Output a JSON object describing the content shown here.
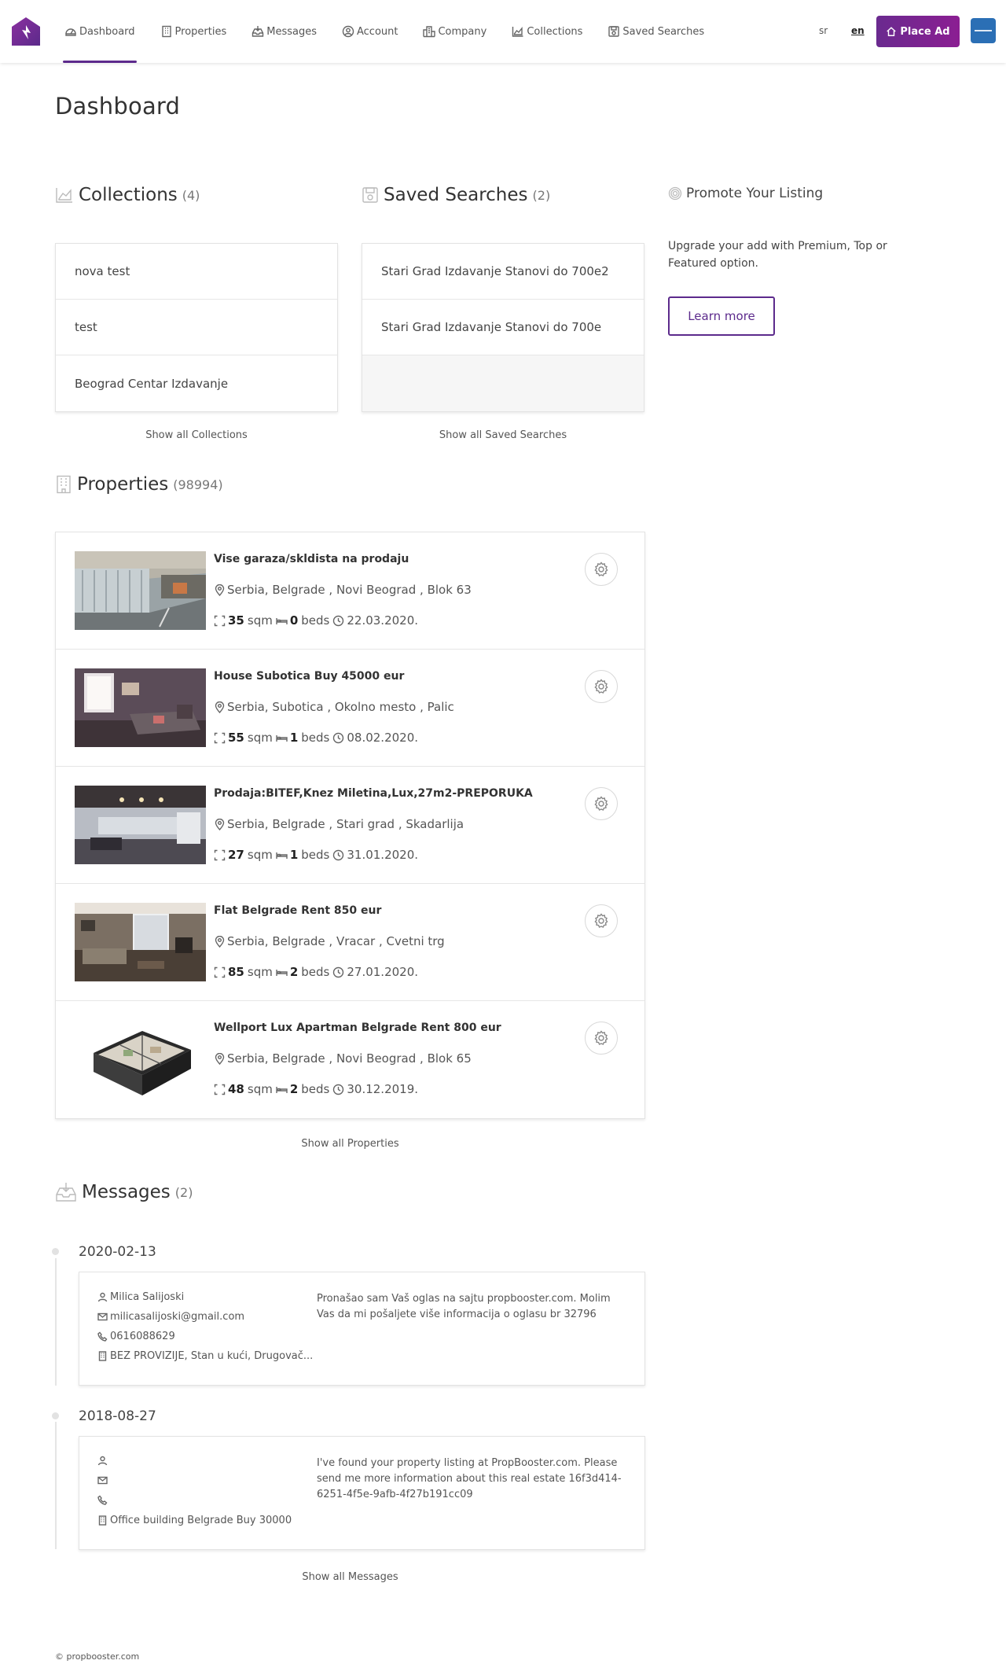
{
  "header": {
    "nav": [
      {
        "label": "Dashboard",
        "icon": "dashboard-icon",
        "active": true
      },
      {
        "label": "Properties",
        "icon": "building-icon"
      },
      {
        "label": "Messages",
        "icon": "inbox-icon"
      },
      {
        "label": "Account",
        "icon": "user-circle-icon"
      },
      {
        "label": "Company",
        "icon": "city-icon"
      },
      {
        "label": "Collections",
        "icon": "chart-folder-icon"
      },
      {
        "label": "Saved Searches",
        "icon": "save-icon"
      }
    ],
    "lang_sr": "sr",
    "lang_en": "en",
    "place_ad": "Place Ad",
    "accent": "#5c2a8c"
  },
  "page_title": "Dashboard",
  "collections": {
    "title": "Collections",
    "count": "(4)",
    "items": [
      "nova test",
      "test",
      "Beograd Centar Izdavanje"
    ],
    "show_all": "Show all Collections"
  },
  "saved_searches": {
    "title": "Saved Searches",
    "count": "(2)",
    "items": [
      "Stari Grad Izdavanje Stanovi do 700e2",
      "Stari Grad Izdavanje Stanovi do 700e"
    ],
    "show_all": "Show all Saved Searches"
  },
  "promote": {
    "title": "Promote Your Listing",
    "text": "Upgrade your add with Premium, Top or Featured option.",
    "button": "Learn more"
  },
  "properties": {
    "title": "Properties",
    "count": "(98994)",
    "unit_area": "sqm",
    "unit_beds": "beds",
    "items": [
      {
        "title": "Vise garaza/skldista na prodaju",
        "location": "Serbia, Belgrade , Novi Beograd , Blok 63",
        "area": "35",
        "beds": "0",
        "date": "22.03.2020."
      },
      {
        "title": "House Subotica Buy 45000 eur",
        "location": "Serbia, Subotica , Okolno mesto , Palic",
        "area": "55",
        "beds": "1",
        "date": "08.02.2020."
      },
      {
        "title": "Prodaja:BITEF,Knez Miletina,Lux,27m2-PREPORUKA",
        "location": "Serbia, Belgrade , Stari grad , Skadarlija",
        "area": "27",
        "beds": "1",
        "date": "31.01.2020."
      },
      {
        "title": "Flat Belgrade Rent 850 eur",
        "location": "Serbia, Belgrade , Vracar , Cvetni trg",
        "area": "85",
        "beds": "2",
        "date": "27.01.2020."
      },
      {
        "title": "Wellport Lux Apartman Belgrade Rent 800 eur",
        "location": "Serbia, Belgrade , Novi Beograd , Blok 65",
        "area": "48",
        "beds": "2",
        "date": "30.12.2019."
      }
    ],
    "show_all": "Show all Properties"
  },
  "messages": {
    "title": "Messages",
    "count": "(2)",
    "items": [
      {
        "date": "2020-02-13",
        "name": "Milica Salijoski",
        "email": "milicasalijoski@gmail.com",
        "phone": "0616088629",
        "property": "BEZ PROVIZIJE, Stan u kući, Drugovač...",
        "body": "Pronašao sam Vaš oglas na sajtu propbooster.com. Molim Vas da mi pošaljete više informacija o oglasu br 32796"
      },
      {
        "date": "2018-08-27",
        "name": "",
        "email": "",
        "phone": "",
        "property": "Office building Belgrade Buy 30000",
        "body": "I've found your property listing at PropBooster.com. Please send me more information about this real estate 16f3d414-6251-4f5e-9afb-4f27b191cc09"
      }
    ],
    "show_all": "Show all Messages"
  },
  "footer": "© propbooster.com"
}
